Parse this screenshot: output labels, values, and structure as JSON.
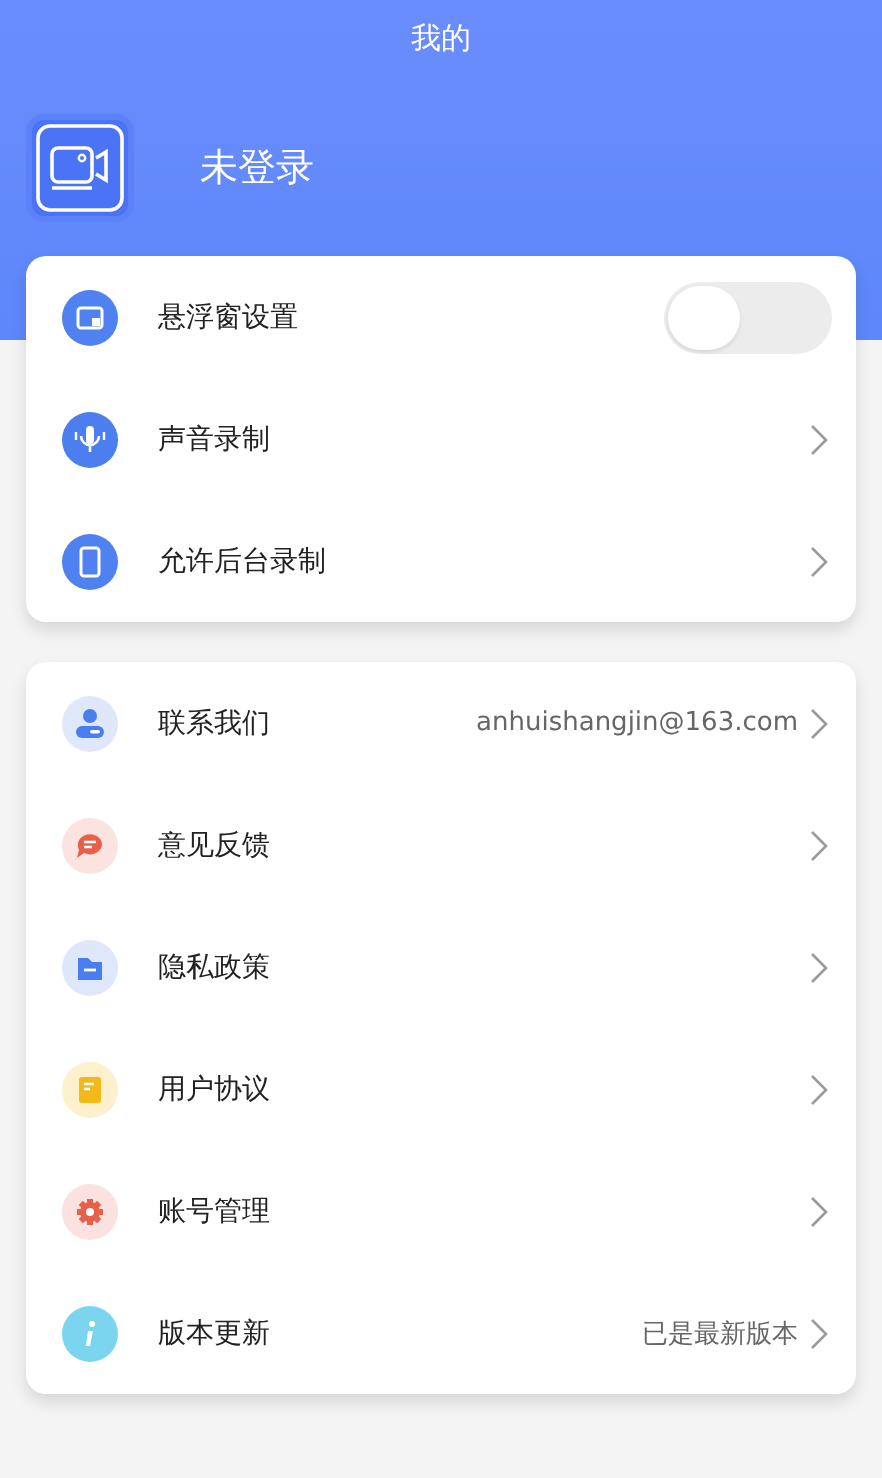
{
  "title": "我的",
  "profile": {
    "name": "未登录"
  },
  "groups": [
    {
      "items": [
        {
          "label": "悬浮窗设置",
          "kind": "toggle",
          "on": false,
          "color": "#5081f0"
        },
        {
          "label": "声音录制",
          "kind": "link",
          "color": "#4d7ef0"
        },
        {
          "label": "允许后台录制",
          "kind": "link",
          "color": "#5081f0"
        }
      ]
    },
    {
      "items": [
        {
          "label": "联系我们",
          "kind": "link",
          "value": "anhuishangjin@163.com",
          "color": "#dfe8fb"
        },
        {
          "label": "意见反馈",
          "kind": "link",
          "color": "#fbe3df"
        },
        {
          "label": "隐私政策",
          "kind": "link",
          "color": "#dfe8fb"
        },
        {
          "label": "用户协议",
          "kind": "link",
          "color": "#fdf0cc"
        },
        {
          "label": "账号管理",
          "kind": "link",
          "color": "#fbe1df"
        },
        {
          "label": "版本更新",
          "kind": "link",
          "value": "已是最新版本",
          "color": "#7cd5ef"
        }
      ]
    }
  ]
}
